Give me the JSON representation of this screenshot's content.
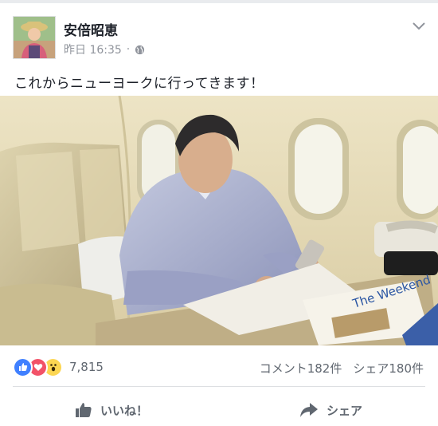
{
  "post": {
    "author": "安倍昭恵",
    "timestamp": "昨日 16:35",
    "separator": "·",
    "privacy_icon": "globe-icon",
    "text": "これからニューヨークに行ってきます！"
  },
  "reactions": {
    "icons": [
      "like-icon",
      "love-icon",
      "wow-icon"
    ],
    "count": "7,815"
  },
  "stats": {
    "comments": "コメント182件",
    "shares": "シェア180件"
  },
  "actions": {
    "like": "いいね！",
    "share": "シェア"
  },
  "colors": {
    "like_blue": "#4080ff",
    "love_red": "#f25268",
    "wow_yellow": "#fcd652",
    "text_gray": "#606770"
  }
}
